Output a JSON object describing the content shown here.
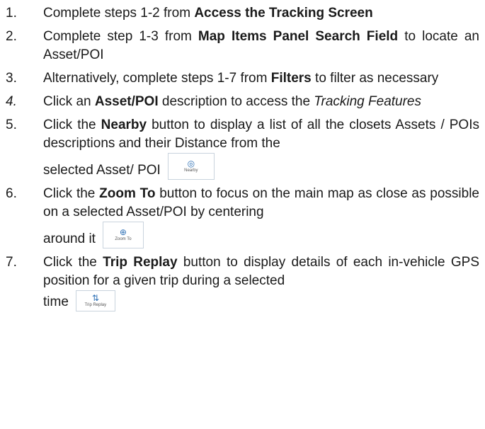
{
  "steps": [
    {
      "num": "1.",
      "parts": [
        "Complete steps 1-2 from ",
        "Access the Tracking Screen"
      ]
    },
    {
      "num": "2.",
      "parts": [
        "Complete step 1-3 from ",
        "Map Items Panel Search Field",
        " to locate an Asset/POI"
      ]
    },
    {
      "num": "3.",
      "parts": [
        "Alternatively, complete steps 1-7 from ",
        "Filters",
        " to filter as necessary"
      ]
    },
    {
      "num": "4.",
      "parts": [
        "Click an ",
        "Asset/POI",
        " description to access the ",
        "Tracking Features"
      ]
    },
    {
      "num": "5.",
      "parts": [
        "Click the ",
        "Nearby",
        " button to display a list of all the closets Assets / POIs descriptions and their Distance from the",
        "selected Asset/ POI"
      ]
    },
    {
      "num": "6.",
      "parts": [
        "Click the ",
        "Zoom To",
        " button to focus on the main map as close as possible on a selected Asset/POI by centering",
        "around it"
      ]
    },
    {
      "num": "7.",
      "parts": [
        "Click the ",
        "Trip Replay",
        " button to display details of each in-vehicle GPS position for a given trip during a selected",
        "time"
      ]
    }
  ],
  "buttons": {
    "nearby": {
      "label": "Nearby",
      "icon": "nearby-icon"
    },
    "zoom": {
      "label": "Zoom To",
      "icon": "zoom-to-icon"
    },
    "trip": {
      "label": "Trip Replay",
      "icon": "trip-replay-icon"
    }
  }
}
